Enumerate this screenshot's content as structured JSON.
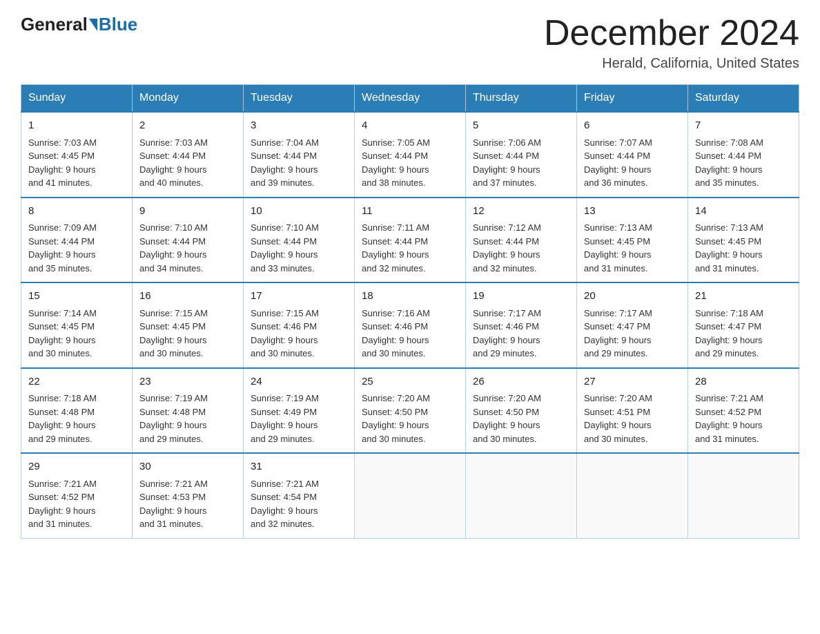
{
  "header": {
    "logo_general": "General",
    "logo_blue": "Blue",
    "month_title": "December 2024",
    "location": "Herald, California, United States"
  },
  "days_of_week": [
    "Sunday",
    "Monday",
    "Tuesday",
    "Wednesday",
    "Thursday",
    "Friday",
    "Saturday"
  ],
  "weeks": [
    [
      {
        "day": "1",
        "sunrise": "7:03 AM",
        "sunset": "4:45 PM",
        "daylight": "9 hours and 41 minutes."
      },
      {
        "day": "2",
        "sunrise": "7:03 AM",
        "sunset": "4:44 PM",
        "daylight": "9 hours and 40 minutes."
      },
      {
        "day": "3",
        "sunrise": "7:04 AM",
        "sunset": "4:44 PM",
        "daylight": "9 hours and 39 minutes."
      },
      {
        "day": "4",
        "sunrise": "7:05 AM",
        "sunset": "4:44 PM",
        "daylight": "9 hours and 38 minutes."
      },
      {
        "day": "5",
        "sunrise": "7:06 AM",
        "sunset": "4:44 PM",
        "daylight": "9 hours and 37 minutes."
      },
      {
        "day": "6",
        "sunrise": "7:07 AM",
        "sunset": "4:44 PM",
        "daylight": "9 hours and 36 minutes."
      },
      {
        "day": "7",
        "sunrise": "7:08 AM",
        "sunset": "4:44 PM",
        "daylight": "9 hours and 35 minutes."
      }
    ],
    [
      {
        "day": "8",
        "sunrise": "7:09 AM",
        "sunset": "4:44 PM",
        "daylight": "9 hours and 35 minutes."
      },
      {
        "day": "9",
        "sunrise": "7:10 AM",
        "sunset": "4:44 PM",
        "daylight": "9 hours and 34 minutes."
      },
      {
        "day": "10",
        "sunrise": "7:10 AM",
        "sunset": "4:44 PM",
        "daylight": "9 hours and 33 minutes."
      },
      {
        "day": "11",
        "sunrise": "7:11 AM",
        "sunset": "4:44 PM",
        "daylight": "9 hours and 32 minutes."
      },
      {
        "day": "12",
        "sunrise": "7:12 AM",
        "sunset": "4:44 PM",
        "daylight": "9 hours and 32 minutes."
      },
      {
        "day": "13",
        "sunrise": "7:13 AM",
        "sunset": "4:45 PM",
        "daylight": "9 hours and 31 minutes."
      },
      {
        "day": "14",
        "sunrise": "7:13 AM",
        "sunset": "4:45 PM",
        "daylight": "9 hours and 31 minutes."
      }
    ],
    [
      {
        "day": "15",
        "sunrise": "7:14 AM",
        "sunset": "4:45 PM",
        "daylight": "9 hours and 30 minutes."
      },
      {
        "day": "16",
        "sunrise": "7:15 AM",
        "sunset": "4:45 PM",
        "daylight": "9 hours and 30 minutes."
      },
      {
        "day": "17",
        "sunrise": "7:15 AM",
        "sunset": "4:46 PM",
        "daylight": "9 hours and 30 minutes."
      },
      {
        "day": "18",
        "sunrise": "7:16 AM",
        "sunset": "4:46 PM",
        "daylight": "9 hours and 30 minutes."
      },
      {
        "day": "19",
        "sunrise": "7:17 AM",
        "sunset": "4:46 PM",
        "daylight": "9 hours and 29 minutes."
      },
      {
        "day": "20",
        "sunrise": "7:17 AM",
        "sunset": "4:47 PM",
        "daylight": "9 hours and 29 minutes."
      },
      {
        "day": "21",
        "sunrise": "7:18 AM",
        "sunset": "4:47 PM",
        "daylight": "9 hours and 29 minutes."
      }
    ],
    [
      {
        "day": "22",
        "sunrise": "7:18 AM",
        "sunset": "4:48 PM",
        "daylight": "9 hours and 29 minutes."
      },
      {
        "day": "23",
        "sunrise": "7:19 AM",
        "sunset": "4:48 PM",
        "daylight": "9 hours and 29 minutes."
      },
      {
        "day": "24",
        "sunrise": "7:19 AM",
        "sunset": "4:49 PM",
        "daylight": "9 hours and 29 minutes."
      },
      {
        "day": "25",
        "sunrise": "7:20 AM",
        "sunset": "4:50 PM",
        "daylight": "9 hours and 30 minutes."
      },
      {
        "day": "26",
        "sunrise": "7:20 AM",
        "sunset": "4:50 PM",
        "daylight": "9 hours and 30 minutes."
      },
      {
        "day": "27",
        "sunrise": "7:20 AM",
        "sunset": "4:51 PM",
        "daylight": "9 hours and 30 minutes."
      },
      {
        "day": "28",
        "sunrise": "7:21 AM",
        "sunset": "4:52 PM",
        "daylight": "9 hours and 31 minutes."
      }
    ],
    [
      {
        "day": "29",
        "sunrise": "7:21 AM",
        "sunset": "4:52 PM",
        "daylight": "9 hours and 31 minutes."
      },
      {
        "day": "30",
        "sunrise": "7:21 AM",
        "sunset": "4:53 PM",
        "daylight": "9 hours and 31 minutes."
      },
      {
        "day": "31",
        "sunrise": "7:21 AM",
        "sunset": "4:54 PM",
        "daylight": "9 hours and 32 minutes."
      },
      null,
      null,
      null,
      null
    ]
  ],
  "labels": {
    "sunrise": "Sunrise:",
    "sunset": "Sunset:",
    "daylight": "Daylight:"
  }
}
